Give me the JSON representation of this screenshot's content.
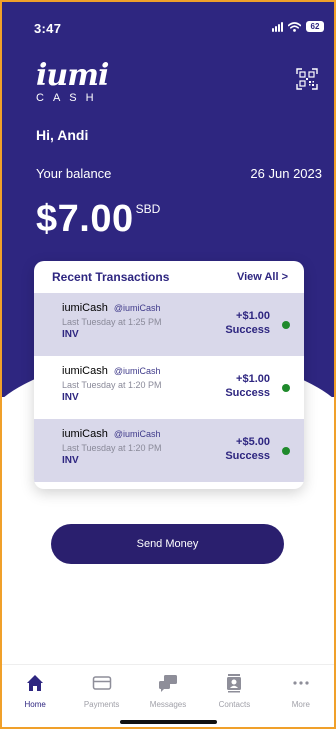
{
  "status_bar": {
    "time": "3:47",
    "battery": "62",
    "icons": [
      "signal-icon",
      "wifi-icon",
      "battery-icon"
    ]
  },
  "brand": {
    "script": "iumi",
    "wordmark": "CASH"
  },
  "header": {
    "qr_icon": "qr-code-icon"
  },
  "greeting": "Hi, Andi",
  "balance": {
    "label": "Your balance",
    "date": "26 Jun 2023",
    "amount": "$7.00",
    "currency": "SBD"
  },
  "recent_transactions": {
    "title": "Recent Transactions",
    "view_all": "View All >",
    "items": [
      {
        "name": "iumiCash",
        "handle": "@iumiCash",
        "time": "Last Tuesday at 1:25 PM",
        "ref": "INV",
        "amount": "+$1.00",
        "status": "Success"
      },
      {
        "name": "iumiCash",
        "handle": "@iumiCash",
        "time": "Last Tuesday at 1:20 PM",
        "ref": "INV",
        "amount": "+$1.00",
        "status": "Success"
      },
      {
        "name": "iumiCash",
        "handle": "@iumiCash",
        "time": "Last Tuesday at 1:20 PM",
        "ref": "INV",
        "amount": "+$5.00",
        "status": "Success"
      }
    ]
  },
  "send_money": "Send Money",
  "tabs": [
    {
      "label": "Home",
      "icon": "home-icon",
      "active": true
    },
    {
      "label": "Payments",
      "icon": "card-icon",
      "active": false
    },
    {
      "label": "Messages",
      "icon": "chat-icon",
      "active": false
    },
    {
      "label": "Contacts",
      "icon": "contacts-icon",
      "active": false
    },
    {
      "label": "More",
      "icon": "more-icon",
      "active": false
    }
  ],
  "colors": {
    "brand": "#2e2680",
    "button": "#2a1f6e",
    "row_highlight": "#d9d8ea",
    "success_dot": "#1f8a2c",
    "frame_border": "#f0a02a"
  }
}
